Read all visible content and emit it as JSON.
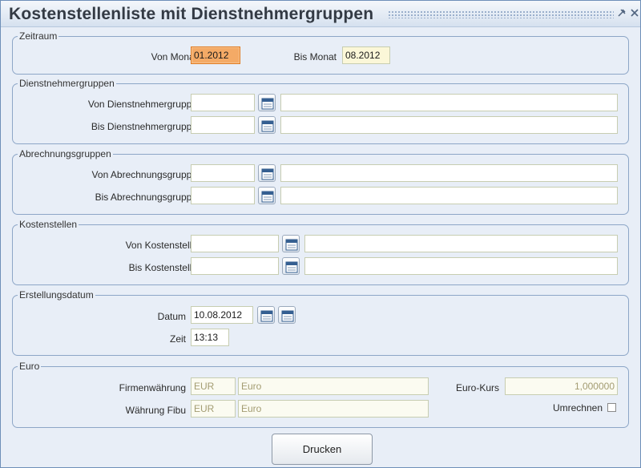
{
  "window": {
    "title": "Kostenstellenliste mit Dienstnehmergruppen"
  },
  "titlebar_icons": [
    "pin-icon",
    "close-icon"
  ],
  "zeitraum": {
    "legend": "Zeitraum",
    "von_label": "Von Monat",
    "von_value": "01.2012",
    "bis_label": "Bis Monat",
    "bis_value": "08.2012"
  },
  "dienstnehmergruppen": {
    "legend": "Dienstnehmergruppen",
    "von_label": "Von Dienstnehmergruppe",
    "von_code": "",
    "von_name": "",
    "bis_label": "Bis Dienstnehmergruppe",
    "bis_code": "",
    "bis_name": ""
  },
  "abrechnungsgruppen": {
    "legend": "Abrechnungsgruppen",
    "von_label": "Von Abrechnungsgruppe",
    "von_code": "",
    "von_name": "",
    "bis_label": "Bis Abrechnungsgruppe",
    "bis_code": "",
    "bis_name": ""
  },
  "kostenstellen": {
    "legend": "Kostenstellen",
    "von_label": "Von Kostenstelle",
    "von_code": "",
    "von_name": "",
    "bis_label": "Bis Kostenstelle",
    "bis_code": "",
    "bis_name": ""
  },
  "erstellungsdatum": {
    "legend": "Erstellungsdatum",
    "datum_label": "Datum",
    "datum_value": "10.08.2012",
    "zeit_label": "Zeit",
    "zeit_value": "13:13"
  },
  "euro": {
    "legend": "Euro",
    "firmen_label": "Firmenwährung",
    "firmen_code": "EUR",
    "firmen_name": "Euro",
    "fibu_label": "Währung Fibu",
    "fibu_code": "EUR",
    "fibu_name": "Euro",
    "kurs_label": "Euro-Kurs",
    "kurs_value": "1,000000",
    "umrechnen_label": "Umrechnen",
    "umrechnen_checked": false
  },
  "actions": {
    "print_label": "Drucken"
  },
  "colors": {
    "active_field": "#f4aa66",
    "highlight_field": "#fbf7d8",
    "group_border": "#8da6c7",
    "window_bg": "#e8eef7"
  }
}
